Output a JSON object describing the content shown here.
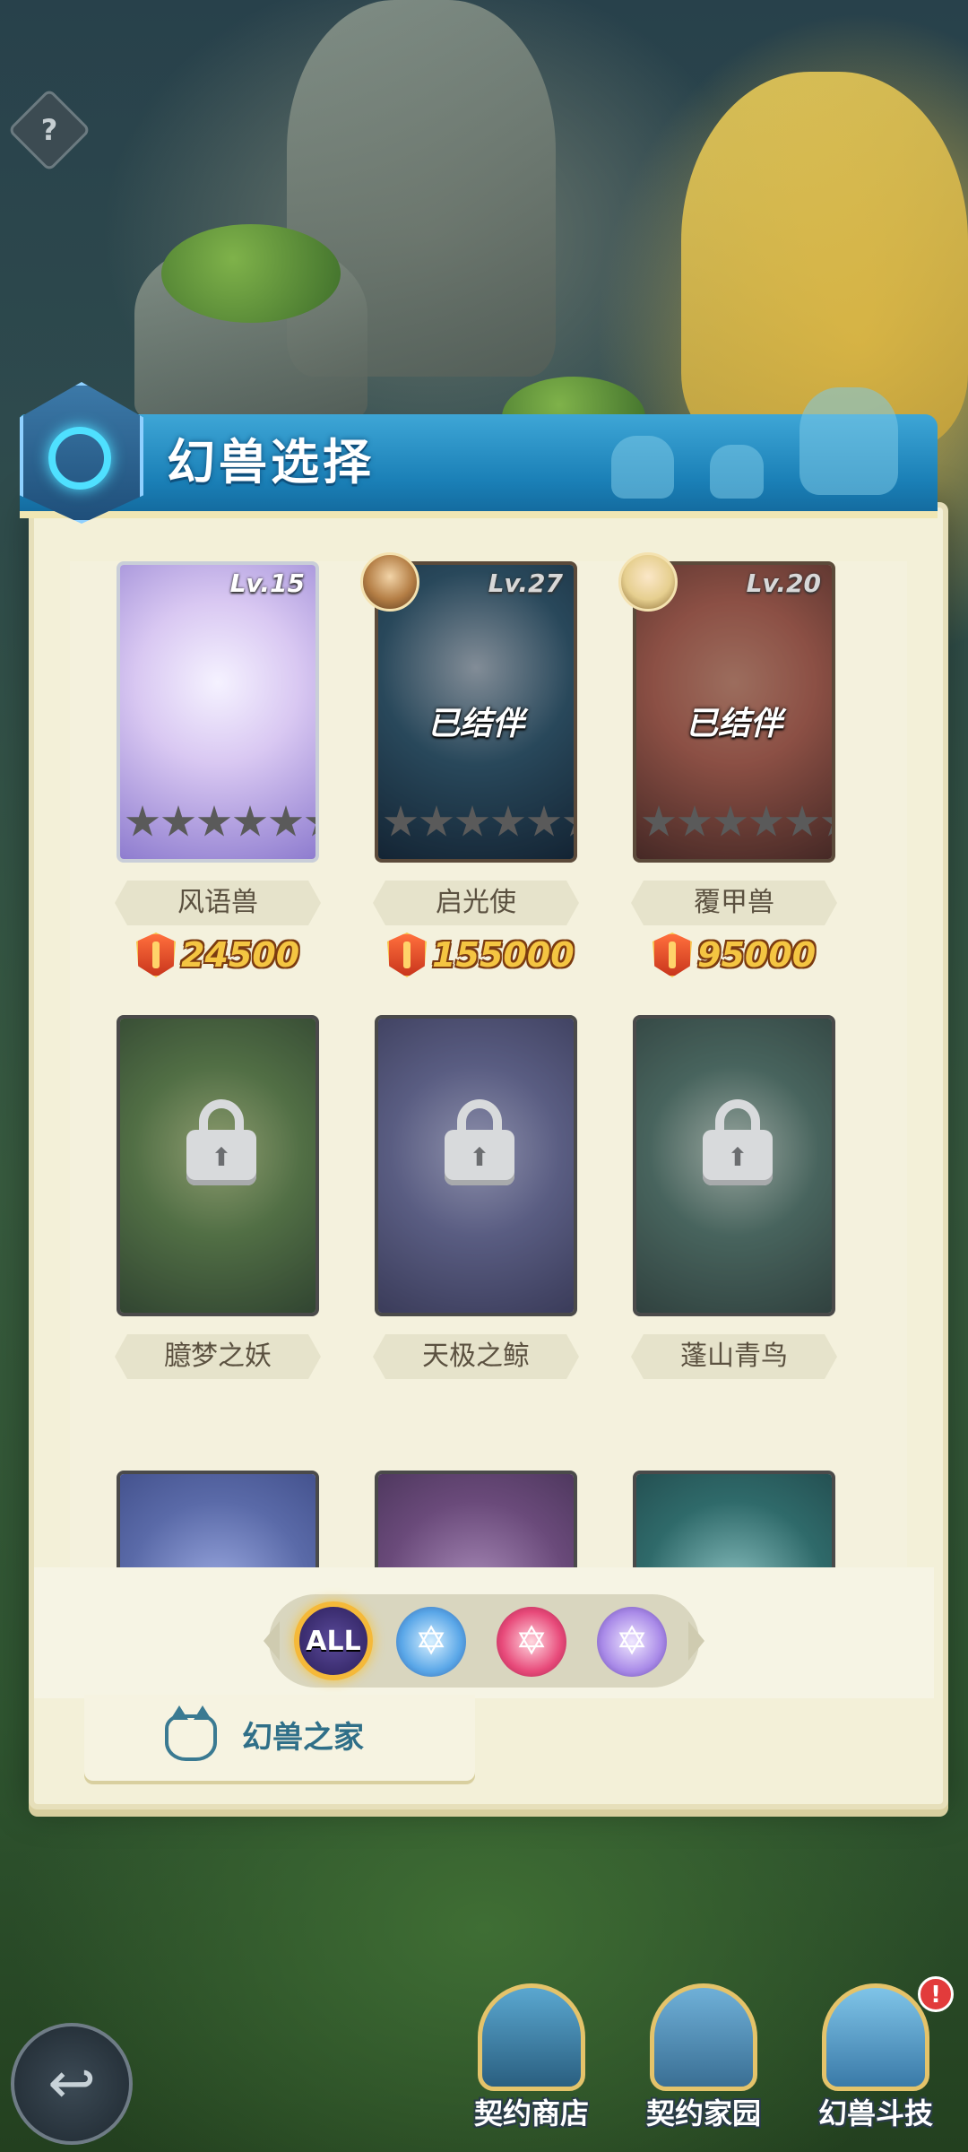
{
  "header": {
    "title": "幻兽选择",
    "help_icon": "?"
  },
  "cards": [
    {
      "name": "风语兽",
      "level": "Lv.15",
      "price": "24500",
      "state": "owned",
      "stars_total": 6,
      "stars_filled": 0,
      "art_colors": [
        "#d9c8f2",
        "#8e7ccf"
      ]
    },
    {
      "name": "启光使",
      "level": "Lv.27",
      "price": "155000",
      "state": "partnered",
      "partner_label": "已结伴",
      "stars_total": 6,
      "stars_filled": 0,
      "art_colors": [
        "#3f6f8c",
        "#1f3850"
      ]
    },
    {
      "name": "覆甲兽",
      "level": "Lv.20",
      "price": "95000",
      "state": "partnered",
      "partner_label": "已结伴",
      "stars_total": 6,
      "stars_filled": 0,
      "art_colors": [
        "#d77b6a",
        "#6b3f3a"
      ]
    },
    {
      "name": "臆梦之妖",
      "state": "locked",
      "art_colors": [
        "#5d8a4a",
        "#2c4a2c"
      ]
    },
    {
      "name": "天极之鲸",
      "state": "locked",
      "art_colors": [
        "#6a6fa8",
        "#3a3c6a"
      ]
    },
    {
      "name": "蓬山青鸟",
      "state": "locked",
      "art_colors": [
        "#4f7a70",
        "#2b4541"
      ]
    },
    {
      "name": "",
      "state": "partial",
      "art_colors": [
        "#5a6aa8",
        "#33407a"
      ]
    },
    {
      "name": "",
      "state": "partial",
      "art_colors": [
        "#6a4a7a",
        "#3a2a4a"
      ]
    },
    {
      "name": "",
      "state": "partial",
      "art_colors": [
        "#2f6a6a",
        "#1c3c40"
      ]
    }
  ],
  "filters": [
    {
      "label": "ALL",
      "selected": true
    },
    {
      "label": "✡",
      "color": "#5aa7e8"
    },
    {
      "label": "✡",
      "color": "#e84a7a"
    },
    {
      "label": "✡",
      "color": "#a98ae8"
    }
  ],
  "home_tab": {
    "label": "幻兽之家"
  },
  "back_label": "↩",
  "bottom_nav": [
    {
      "label": "契约商店",
      "icon": "shop-icon"
    },
    {
      "label": "契约家园",
      "icon": "home-icon"
    },
    {
      "label": "幻兽斗技",
      "icon": "battle-icon",
      "alert": "!"
    }
  ]
}
